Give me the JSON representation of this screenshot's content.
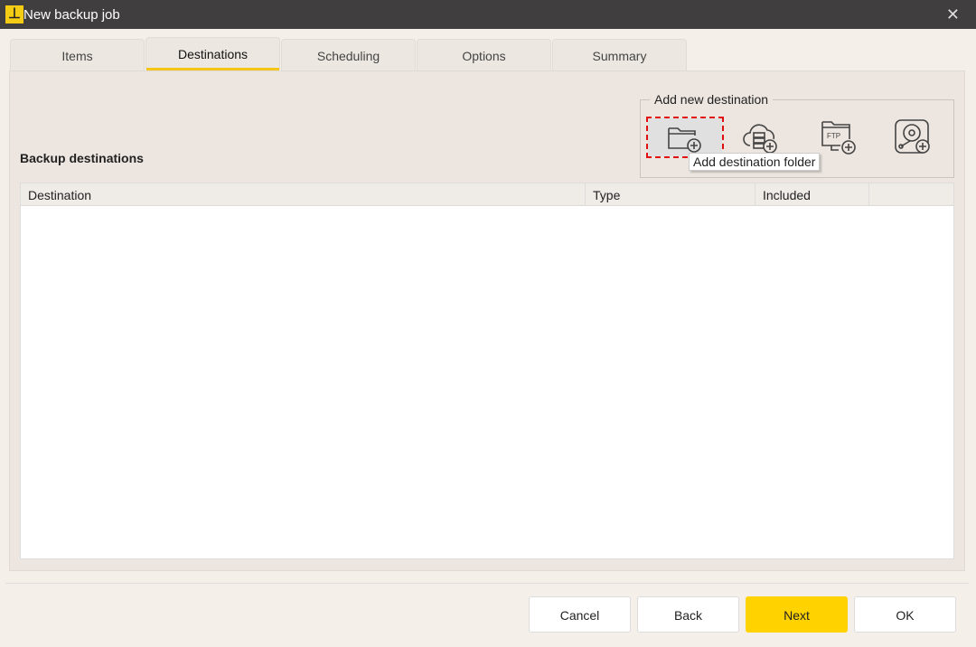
{
  "window": {
    "title": "New backup job",
    "close": "✕",
    "logo": "⊥"
  },
  "tabs": [
    {
      "label": "Items"
    },
    {
      "label": "Destinations"
    },
    {
      "label": "Scheduling"
    },
    {
      "label": "Options"
    },
    {
      "label": "Summary"
    }
  ],
  "section_title": "Backup destinations",
  "add_group": {
    "label": "Add new destination",
    "ftp_text": "FTP",
    "tooltip": "Add destination folder"
  },
  "table": {
    "columns": [
      "Destination",
      "Type",
      "Included",
      ""
    ],
    "rows": []
  },
  "buttons": {
    "cancel": "Cancel",
    "back": "Back",
    "next": "Next",
    "ok": "OK"
  },
  "colors": {
    "accent": "#ffd200",
    "titlebar": "#403e3f"
  }
}
